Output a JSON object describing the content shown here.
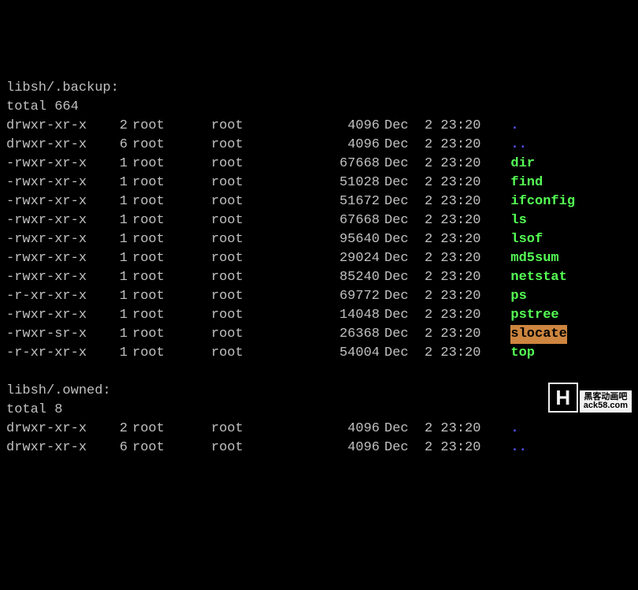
{
  "sections": [
    {
      "header": "libsh/.backup:",
      "total": "total 664",
      "rows": [
        {
          "perms": "drwxr-xr-x",
          "links": "2",
          "owner": "root",
          "group": "root",
          "size": "4096",
          "date": "Dec  2 23:20",
          "name": ".",
          "cls": "c-blue"
        },
        {
          "perms": "drwxr-xr-x",
          "links": "6",
          "owner": "root",
          "group": "root",
          "size": "4096",
          "date": "Dec  2 23:20",
          "name": "..",
          "cls": "c-blue"
        },
        {
          "perms": "-rwxr-xr-x",
          "links": "1",
          "owner": "root",
          "group": "root",
          "size": "67668",
          "date": "Dec  2 23:20",
          "name": "dir",
          "cls": "c-green"
        },
        {
          "perms": "-rwxr-xr-x",
          "links": "1",
          "owner": "root",
          "group": "root",
          "size": "51028",
          "date": "Dec  2 23:20",
          "name": "find",
          "cls": "c-green"
        },
        {
          "perms": "-rwxr-xr-x",
          "links": "1",
          "owner": "root",
          "group": "root",
          "size": "51672",
          "date": "Dec  2 23:20",
          "name": "ifconfig",
          "cls": "c-green"
        },
        {
          "perms": "-rwxr-xr-x",
          "links": "1",
          "owner": "root",
          "group": "root",
          "size": "67668",
          "date": "Dec  2 23:20",
          "name": "ls",
          "cls": "c-green"
        },
        {
          "perms": "-rwxr-xr-x",
          "links": "1",
          "owner": "root",
          "group": "root",
          "size": "95640",
          "date": "Dec  2 23:20",
          "name": "lsof",
          "cls": "c-green"
        },
        {
          "perms": "-rwxr-xr-x",
          "links": "1",
          "owner": "root",
          "group": "root",
          "size": "29024",
          "date": "Dec  2 23:20",
          "name": "md5sum",
          "cls": "c-green"
        },
        {
          "perms": "-rwxr-xr-x",
          "links": "1",
          "owner": "root",
          "group": "root",
          "size": "85240",
          "date": "Dec  2 23:20",
          "name": "netstat",
          "cls": "c-green"
        },
        {
          "perms": "-r-xr-xr-x",
          "links": "1",
          "owner": "root",
          "group": "root",
          "size": "69772",
          "date": "Dec  2 23:20",
          "name": "ps",
          "cls": "c-green"
        },
        {
          "perms": "-rwxr-xr-x",
          "links": "1",
          "owner": "root",
          "group": "root",
          "size": "14048",
          "date": "Dec  2 23:20",
          "name": "pstree",
          "cls": "c-green"
        },
        {
          "perms": "-rwxr-sr-x",
          "links": "1",
          "owner": "root",
          "group": "root",
          "size": "26368",
          "date": "Dec  2 23:20",
          "name": "slocate",
          "cls": "c-hl"
        },
        {
          "perms": "-r-xr-xr-x",
          "links": "1",
          "owner": "root",
          "group": "root",
          "size": "54004",
          "date": "Dec  2 23:20",
          "name": "top",
          "cls": "c-green"
        }
      ]
    },
    {
      "header": "libsh/.owned:",
      "total": "total 8",
      "rows": [
        {
          "perms": "drwxr-xr-x",
          "links": "2",
          "owner": "root",
          "group": "root",
          "size": "4096",
          "date": "Dec  2 23:20",
          "name": ".",
          "cls": "c-blue"
        },
        {
          "perms": "drwxr-xr-x",
          "links": "6",
          "owner": "root",
          "group": "root",
          "size": "4096",
          "date": "Dec  2 23:20",
          "name": "..",
          "cls": "c-blue"
        }
      ]
    }
  ],
  "watermark": {
    "logo": "H",
    "cn": "黑客动画吧",
    "site": "ack58.com"
  }
}
